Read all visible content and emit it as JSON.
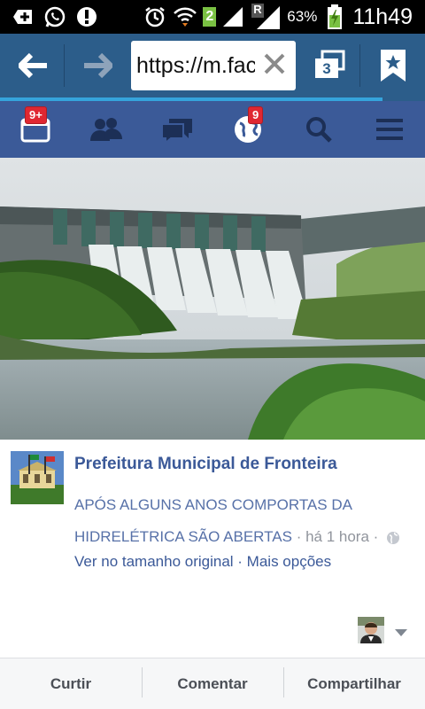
{
  "status_bar": {
    "battery_percent": "63%",
    "sim_badge": "2",
    "roaming_badge": "R",
    "clock": "11h49",
    "icons": [
      "add-notification-icon",
      "whatsapp-icon",
      "alert-icon",
      "alarm-icon",
      "wifi-icon",
      "signal-icon",
      "battery-charging-icon"
    ]
  },
  "browser": {
    "url": "https://m.facebook.com",
    "tab_count": "3",
    "load_progress_fraction": 0.9,
    "icons": [
      "back-arrow-icon",
      "forward-arrow-icon",
      "clear-icon",
      "tabs-icon",
      "bookmark-icon"
    ]
  },
  "fb_nav": {
    "feed_badge": "9+",
    "notifications_badge": "9",
    "icons": [
      "news-feed-icon",
      "friends-icon",
      "messages-icon",
      "notifications-globe-icon",
      "search-icon",
      "menu-icon"
    ],
    "brand_color": "#3b5a98"
  },
  "post": {
    "page_name": "Prefeitura Municipal de Fronteira",
    "caption": "APÓS ALGUNS ANOS COMPORTAS DA HIDRELÉTRICA SÃO ABERTAS",
    "time": "· há 1 hora ·",
    "view_original": "Ver no tamanho original",
    "more_options": "· Mais opções"
  },
  "actions": {
    "like": "Curtir",
    "comment": "Comentar",
    "share": "Compartilhar"
  }
}
